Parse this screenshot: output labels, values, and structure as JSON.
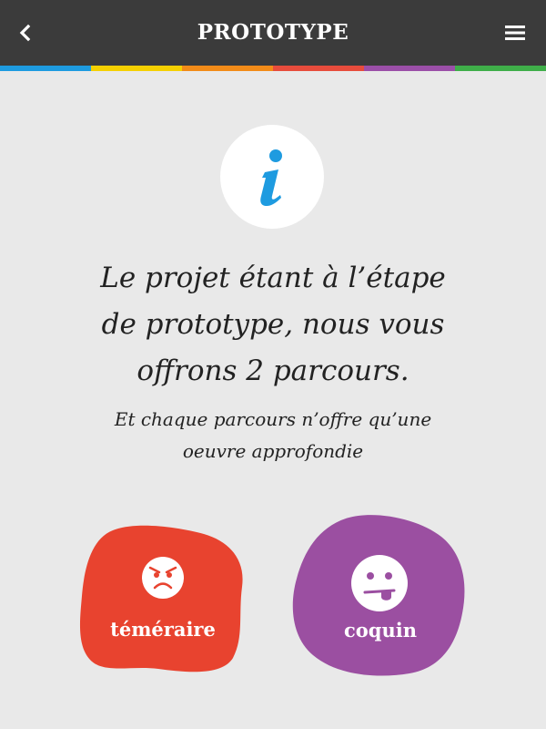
{
  "header": {
    "title": "PROTOTYPE",
    "back_icon": "chevron-left-icon",
    "menu_icon": "hamburger-menu-icon",
    "background": "#3b3b3b"
  },
  "stripe_colors": [
    "#1e9be0",
    "#f5d000",
    "#f28b18",
    "#e74c3c",
    "#9b4fa8",
    "#3fae49"
  ],
  "info": {
    "icon": "info-icon",
    "accent": "#1e9be0"
  },
  "content": {
    "headline_lines": [
      "Le projet étant à l’étape",
      "de prototype, nous vous",
      "offrons 2 parcours."
    ],
    "subtext_lines": [
      "Et chaque parcours n’offre qu’une",
      "oeuvre approfondie"
    ]
  },
  "choices": [
    {
      "label": "téméraire",
      "icon": "angry-face-icon",
      "color": "#e8432f"
    },
    {
      "label": "coquin",
      "icon": "tongue-out-face-icon",
      "color": "#9b4fa1"
    }
  ]
}
